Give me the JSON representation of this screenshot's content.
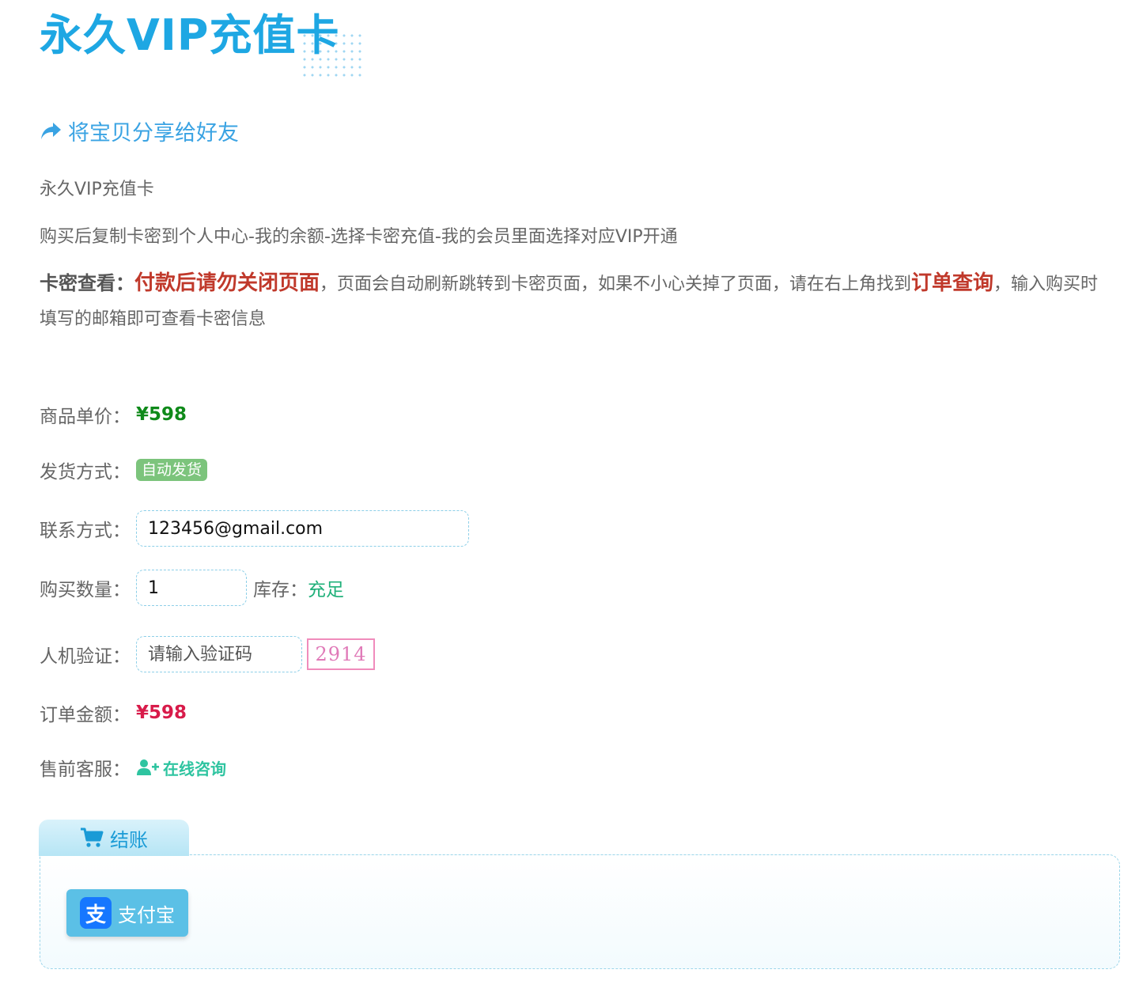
{
  "header": {
    "title": "永久VIP充值卡"
  },
  "share": {
    "label": "将宝贝分享给好友"
  },
  "description": {
    "name": "永久VIP充值卡",
    "instructions": "购买后复制卡密到个人中心-我的余额-选择卡密充值-我的会员里面选择对应VIP开通"
  },
  "notice": {
    "label": "卡密查看",
    "colon": "：",
    "warning": "付款后请勿关闭页面",
    "text1": "，页面会自动刷新跳转到卡密页面，如果不小心关掉了页面，请在右上角找到",
    "link": "订单查询",
    "text2": "，输入购买时填写的邮箱即可查看卡密信息"
  },
  "form": {
    "price_label": "商品单价：",
    "price_value": "¥598",
    "delivery_label": "发货方式：",
    "delivery_value": "自动发货",
    "contact_label": "联系方式：",
    "contact_value": "123456@gmail.com",
    "quantity_label": "购买数量：",
    "quantity_value": "1",
    "stock_label": "库存：",
    "stock_value": "充足",
    "captcha_label": "人机验证：",
    "captcha_placeholder": "请输入验证码",
    "captcha_code": "2914",
    "total_label": "订单金额：",
    "total_value": "¥598",
    "service_label": "售前客服：",
    "service_value": "在线咨询"
  },
  "checkout": {
    "tab_label": "结账",
    "payment_method": "支付宝",
    "payment_logo": "支"
  },
  "icons": {
    "share": "share-icon",
    "user_add": "user-plus-icon",
    "cart": "cart-icon",
    "alipay": "alipay-icon"
  },
  "colors": {
    "title": "#1ea7e3",
    "warning": "#c0392b",
    "price": "#0f8a1a",
    "total": "#d81b4a",
    "stock": "#20b07a",
    "badge": "#7cc47c",
    "alipay_button": "#5bc0e6"
  }
}
